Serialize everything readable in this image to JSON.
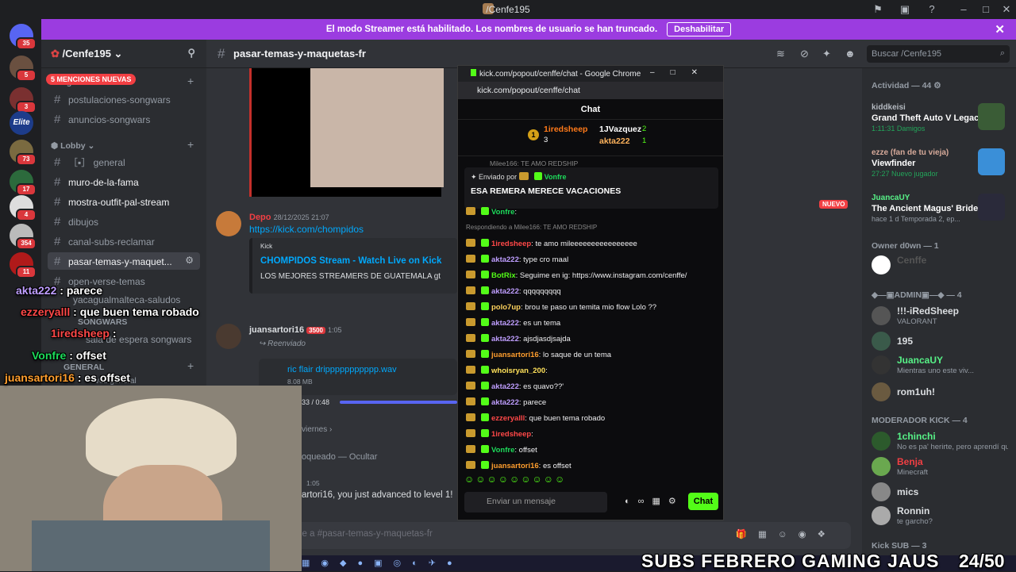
{
  "window": {
    "title": "/Cenfe195"
  },
  "banner": {
    "text": "El modo Streamer está habilitado. Los nombres de usuario se han truncado.",
    "button": "Deshabilitar"
  },
  "servers": {
    "badges": [
      "35",
      "5",
      "3",
      "73",
      "17",
      "4",
      "354",
      "11"
    ],
    "elite": "Elite"
  },
  "guild": {
    "name": "/Cenfe195",
    "mentions": "5 MENCIONES NUEVAS"
  },
  "channels": {
    "cat_songwars": "Songwars",
    "items_top": [
      "postulaciones-songwars",
      "anuncios-songwars"
    ],
    "cat_lobby": "Lobby",
    "general": "general",
    "lobby_items": [
      "muro-de-la-fama",
      "mostra-outfit-pal-stream",
      "dibujos",
      "canal-subs-reclamar",
      "pasar-temas-y-maquet..."
    ],
    "extra": [
      "open-verse-temas",
      "yacagualmalteca-saludos"
    ],
    "cat_sw2": "SONGWARS",
    "voice": "sala de espera songwars",
    "cat_general": "GENERAL",
    "extra2": "voz general"
  },
  "topbar": {
    "channel": "pasar-temas-y-maquetas-fr",
    "search": "Buscar /Cenfe195"
  },
  "messages": [
    {
      "user": "Depo",
      "time": "28/12/2025 21:07",
      "link": "https://kick.com/chompidos",
      "embed_site": "Kick",
      "embed_title": "CHOMPIDOS Stream - Watch Live on Kick",
      "embed_desc": "LOS MEJORES STREAMERS DE GUATEMALA gt"
    },
    {
      "user": "juansartori16",
      "badge": "3500",
      "time": "1:05",
      "note": "Reenviado",
      "file": "ric flair drippppppppppp.wav",
      "size": "8.08 MB",
      "audio_time": "33 / 0:48"
    }
  ],
  "main_misc": {
    "new": "NUEVO",
    "viernes": "viernes",
    "blocked": "oqueado — Ocultar",
    "time2": "1:05",
    "level": "artori16, you just advanced to level 1!",
    "input": "je a #pasar-temas-y-maquetas-fr"
  },
  "popup": {
    "title": "kick.com/popout/cenffe/chat - Google Chrome",
    "url": "kick.com/popout/cenffe/chat",
    "header": "Chat",
    "gifters": {
      "first": "1iredsheep",
      "first_n": "3",
      "second": "1JVazquez",
      "second_n": "2",
      "third": "akta222",
      "third_n": "1"
    },
    "reply_cut": "Milee166: TE AMO REDSHIP",
    "pinned_by": "Enviado por",
    "pinned_user": "Vonfre",
    "pinned_msg": "ESA REMERA MERECE VACACIONES",
    "chat": [
      {
        "user": "Vonfre",
        "color": "#1ddc5b",
        "text": ""
      },
      {
        "user": "",
        "color": "#888",
        "text": "Respondiendo a Milee166: TE AMO REDSHIP"
      },
      {
        "user": "1iredsheep",
        "color": "#ff4848",
        "text": "te amo mileeeeeeeeeeeeeeee"
      },
      {
        "user": "akta222",
        "color": "#bf9eff",
        "text": "type cro maal"
      },
      {
        "user": "BotRix",
        "color": "#53fc18",
        "text": "Seguime en ig: https://www.instagram.com/cenffe/"
      },
      {
        "user": "akta222",
        "color": "#bf9eff",
        "text": "qqqqqqqqq"
      },
      {
        "user": "polo7up",
        "color": "#ffd35d",
        "text": "brou te paso un temita mio flow Lolo ??"
      },
      {
        "user": "akta222",
        "color": "#bf9eff",
        "text": "es un tema"
      },
      {
        "user": "akta222",
        "color": "#bf9eff",
        "text": "ajsdjasdjsajda"
      },
      {
        "user": "juansartori16",
        "color": "#ff9e2e",
        "text": "lo saque de un tema"
      },
      {
        "user": "whoisryan_200",
        "color": "#ffe15a",
        "text": ""
      },
      {
        "user": "akta222",
        "color": "#bf9eff",
        "text": "es quavo??'"
      },
      {
        "user": "akta222",
        "color": "#bf9eff",
        "text": "parece"
      },
      {
        "user": "ezzeryalll",
        "color": "#ff4848",
        "text": "que buen tema robado"
      },
      {
        "user": "1iredsheep",
        "color": "#ff4848",
        "text": ""
      },
      {
        "user": "Vonfre",
        "color": "#1ddc5b",
        "text": "offset"
      },
      {
        "user": "juansartori16",
        "color": "#ff9e2e",
        "text": "es offset"
      }
    ],
    "input": "Enviar un mensaje",
    "send": "Chat"
  },
  "members": {
    "activity_header": "Actividad — 44",
    "activities": [
      {
        "name": "kiddkeisi",
        "game": "Grand Theft Auto V Legacy",
        "detail": "1:11:31 Damigos"
      },
      {
        "name": "ezze (fan de tu vieja)",
        "game": "Viewfinder",
        "detail": "27:27 Nuevo jugador"
      },
      {
        "name": "JuancaUY",
        "game": "The Ancient Magus' Bride",
        "detail": "hace 1 d Temporada 2, ep..."
      }
    ],
    "owner_header": "Owner d0wn — 1",
    "owner": "Cenffe",
    "admin_header": "◆—▣ADMIN▣—◆ — 4",
    "admins": [
      {
        "n": "!!!-iRedSheep",
        "s": "VALORANT",
        "c": "#dbdee1"
      },
      {
        "n": "195",
        "s": "",
        "c": "#dbdee1"
      },
      {
        "n": "JuancaUY",
        "s": "Mientras uno este viv...",
        "c": "#57f287"
      },
      {
        "n": "rom1uh!",
        "s": "",
        "c": "#dbdee1"
      }
    ],
    "mod_header": "MODERADOR KICK — 4",
    "mods": [
      {
        "n": "1chinchi",
        "s": "No es pa' herirte, pero aprendí que...",
        "c": "#57f287"
      },
      {
        "n": "Benja",
        "s": "Minecraft",
        "c": "#f23f43"
      },
      {
        "n": "mics",
        "s": "",
        "c": "#dbdee1"
      },
      {
        "n": "Ronnin",
        "s": "te garcho?",
        "c": "#dbdee1"
      }
    ],
    "sub_header": "Kick SUB — 3"
  },
  "overlay": {
    "lines": [
      {
        "user": "akta222",
        "text": " : parece"
      },
      {
        "user": "ezzeryalll",
        "text": " : que buen tema robado"
      },
      {
        "user": "1iredsheep",
        "text": " : "
      },
      {
        "user": "Vonfre",
        "text": " : offset"
      },
      {
        "user": "juansartori16",
        "text": " : es offset"
      }
    ],
    "subs": "SUBS FEBRERO GAMING JAUS",
    "count": "24/50"
  }
}
